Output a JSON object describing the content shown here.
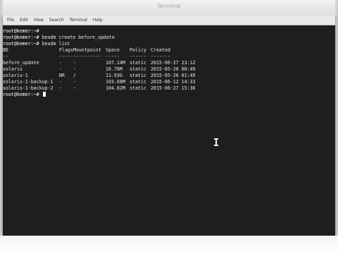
{
  "window": {
    "title": "Terminal"
  },
  "menu": [
    "File",
    "Edit",
    "View",
    "Search",
    "Terminal",
    "Help"
  ],
  "terminal": {
    "prompt": "root@kemer:~#",
    "lines_before": [
      {
        "prompt": "root@kemer:~#",
        "cmd": ""
      },
      {
        "prompt": "root@kemer:~#",
        "cmd": " beadm create before_update"
      },
      {
        "prompt": "root@kemer:~#",
        "cmd": " beadm list"
      }
    ],
    "header": [
      "BE",
      "Flags",
      "Mountpoint",
      "Space",
      "Policy",
      "Created"
    ],
    "divider": [
      "--",
      "-----",
      "----------",
      "-----",
      "------",
      "-------"
    ],
    "rows": [
      [
        "before_update",
        "-",
        "-",
        "107.14M",
        "static",
        "2015-06-27 23:12"
      ],
      [
        "solaris",
        "-",
        "-",
        "16.78M",
        "static",
        "2015-05-26 00:49"
      ],
      [
        "solaris-1",
        "NR",
        "/",
        "11.93G",
        "static",
        "2015-05-26 01:49"
      ],
      [
        "solaris-1-backup-1",
        "-",
        "-",
        "103.68M",
        "static",
        "2015-06-12 14:33"
      ],
      [
        "solaris-1-backup-2",
        "-",
        "-",
        "104.82M",
        "static",
        "2015-06-27 15:36"
      ]
    ],
    "final_prompt": "root@kemer:~#"
  }
}
